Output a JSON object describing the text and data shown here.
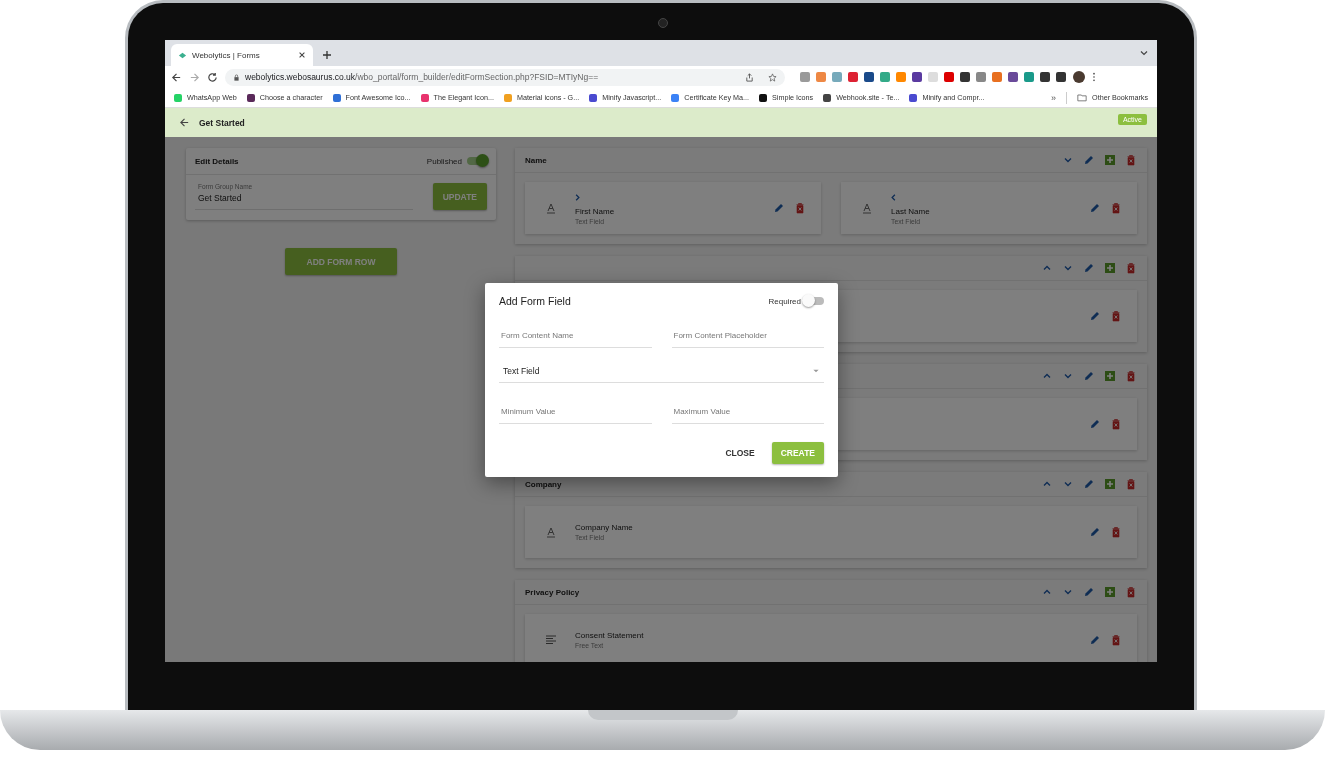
{
  "browser": {
    "tab_title": "Webolytics | Forms",
    "url_host": "webolytics.webosaurus.co.uk",
    "url_path": "/wbo_portal/form_builder/editFormSection.php?FSID=MTIyNg==",
    "bookmarks": [
      {
        "label": "WhatsApp Web",
        "color": "#25d366"
      },
      {
        "label": "Choose a character",
        "color": "#5a2a5a"
      },
      {
        "label": "Font Awesome Ico...",
        "color": "#2f6fd6"
      },
      {
        "label": "The Elegant Icon...",
        "color": "#e8336d"
      },
      {
        "label": "Material icons - G...",
        "color": "#f0a020"
      },
      {
        "label": "Minify Javascript...",
        "color": "#4a4ad0"
      },
      {
        "label": "Certificate Key Ma...",
        "color": "#3b82f6"
      },
      {
        "label": "Simple Icons",
        "color": "#111111"
      },
      {
        "label": "Webhook.site - Te...",
        "color": "#444444"
      },
      {
        "label": "Minify and Compr...",
        "color": "#4a4ad0"
      }
    ],
    "overflow": "»",
    "other_bookmarks": "Other Bookmarks"
  },
  "header": {
    "title": "Get Started",
    "status": "Active"
  },
  "details": {
    "title": "Edit Details",
    "published_label": "Published",
    "published": true,
    "name_label": "Form Group Name",
    "name_value": "Get Started",
    "update_button": "UPDATE"
  },
  "add_row_button": "ADD FORM ROW",
  "sections": [
    {
      "title": "Name",
      "can_move_up": false,
      "can_move_down": true,
      "fields": [
        {
          "name": "First Name",
          "type": "Text Field",
          "kind": "text",
          "can_move_left": false,
          "can_move_right": true
        },
        {
          "name": "Last Name",
          "type": "Text Field",
          "kind": "text",
          "can_move_left": true,
          "can_move_right": false
        }
      ]
    },
    {
      "can_move_up": true,
      "can_move_down": true,
      "fields": [
        {
          "kind": "covered"
        }
      ]
    },
    {
      "can_move_up": true,
      "can_move_down": true,
      "fields": [
        {
          "kind": "covered"
        }
      ]
    },
    {
      "title": "Company",
      "can_move_up": true,
      "can_move_down": true,
      "fields": [
        {
          "name": "Company Name",
          "type": "Text Field",
          "kind": "text"
        }
      ]
    },
    {
      "title": "Privacy Policy",
      "can_move_up": true,
      "can_move_down": true,
      "fields": [
        {
          "name": "Consent Statement",
          "type": "Free Text",
          "kind": "free_text"
        }
      ]
    }
  ],
  "dialog": {
    "title": "Add Form Field",
    "required_label": "Required",
    "required": false,
    "fields": [
      {
        "placeholder": "Form Content Name"
      },
      {
        "placeholder": "Form Content Placeholder"
      }
    ],
    "select_value": "Text Field",
    "range_fields": [
      {
        "placeholder": "Minimum Value"
      },
      {
        "placeholder": "Maximum Value"
      }
    ],
    "close_button": "CLOSE",
    "create_button": "CREATE"
  }
}
